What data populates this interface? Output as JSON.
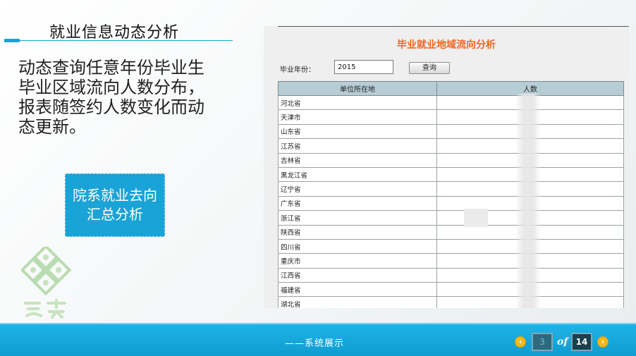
{
  "slide": {
    "title": "就业信息动态分析",
    "description": "动态查询任意年份毕业生毕业区域流向人数分布，报表随签约人数变化而动态更新。",
    "callout": "院系就业去向汇总分析",
    "logo_icon": "clover-logo-icon"
  },
  "report": {
    "title": "毕业就业地域流向分析",
    "year_label": "毕业年份：",
    "year_value": "2015",
    "query_button": "查询",
    "columns": [
      "单位所在地",
      "人数"
    ],
    "rows": [
      "河北省",
      "天津市",
      "山东省",
      "江苏省",
      "吉林省",
      "黑龙江省",
      "辽宁省",
      "广东省",
      "浙江省",
      "陕西省",
      "四川省",
      "重庆市",
      "江西省",
      "福建省",
      "湖北省"
    ]
  },
  "footer": {
    "text": "——系统展示",
    "current_page": "3",
    "of_label": "of",
    "total_pages": "14",
    "prev_icon": "chevron-left-icon",
    "next_icon": "chevron-right-icon"
  },
  "colors": {
    "accent": "#1aa3d6",
    "report_title": "#f26522",
    "footer_bar": "#0e9cd1"
  }
}
